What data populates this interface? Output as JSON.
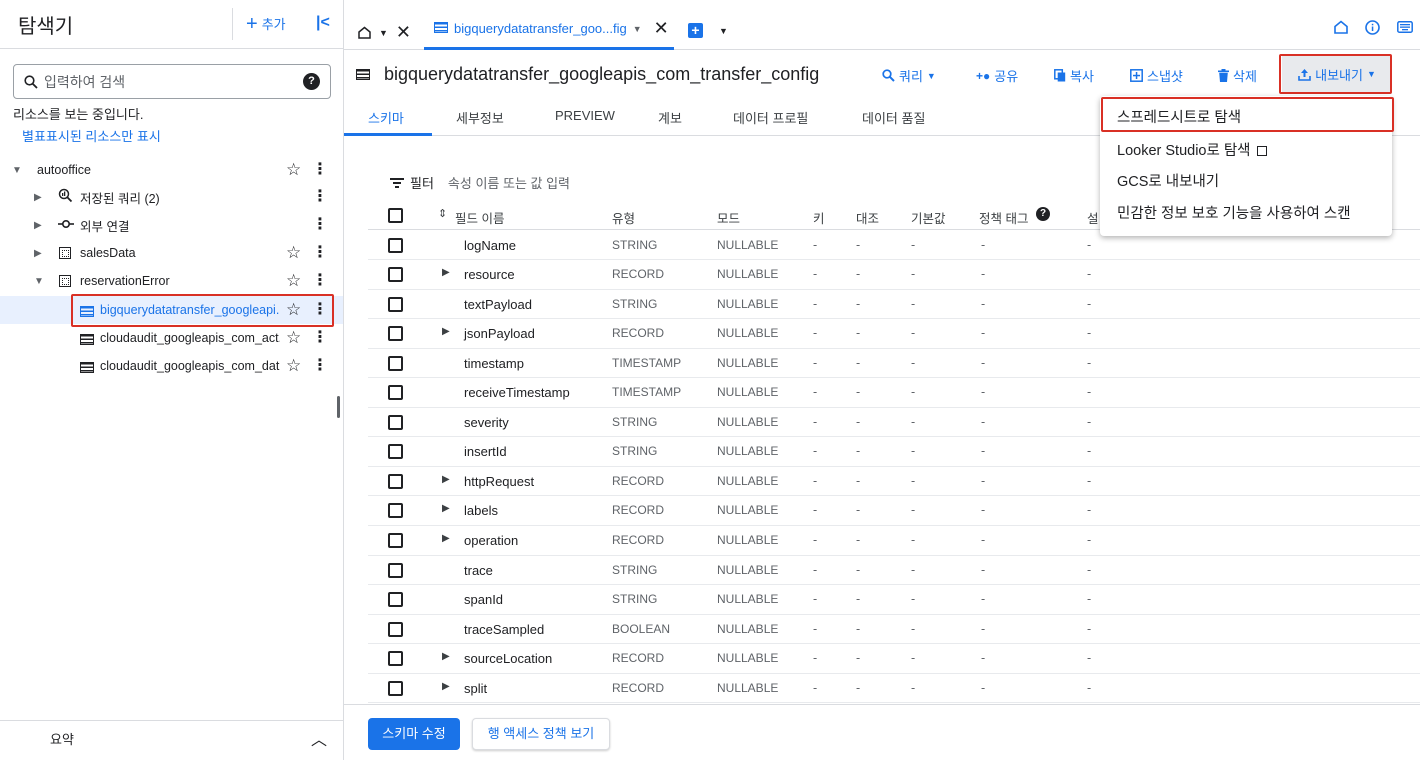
{
  "explorer": {
    "title": "탐색기",
    "add_label": "추가",
    "search_placeholder": "입력하여 검색",
    "info_text": "리소스를 보는 중입니다.",
    "info_link": "별표표시된 리소스만 표시",
    "tree": [
      {
        "label": "autooffice",
        "level": 0,
        "expanded": true,
        "icon": "none",
        "starred": false
      },
      {
        "label": "저장된 쿼리 (2)",
        "level": 1,
        "expanded": false,
        "icon": "saved-query-icon",
        "star": false
      },
      {
        "label": "외부 연결",
        "level": 1,
        "expanded": false,
        "icon": "external-connection-icon",
        "star": false
      },
      {
        "label": "salesData",
        "level": 1,
        "expanded": false,
        "icon": "dataset-icon",
        "star": true
      },
      {
        "label": "reservationError",
        "level": 1,
        "expanded": true,
        "icon": "dataset-icon",
        "star": true
      },
      {
        "label": "bigquerydatatransfer_googleapi...",
        "level": 2,
        "icon": "table-icon",
        "star": true,
        "selected": true
      },
      {
        "label": "cloudaudit_googleapis_com_act...",
        "level": 2,
        "icon": "table-icon",
        "star": true
      },
      {
        "label": "cloudaudit_googleapis_com_dat...",
        "level": 2,
        "icon": "table-icon",
        "star": true
      }
    ],
    "summary_label": "요약"
  },
  "tabs": {
    "active_label": "bigquerydatatransfer_goo...fig"
  },
  "header": {
    "table_title": "bigquerydatatransfer_googleapis_com_transfer_config",
    "actions": {
      "query": "쿼리",
      "share": "공유",
      "copy": "복사",
      "snapshot": "스냅샷",
      "delete": "삭제",
      "export": "내보내기"
    }
  },
  "subtabs": [
    "스키마",
    "세부정보",
    "PREVIEW",
    "계보",
    "데이터 프로필",
    "데이터 품질"
  ],
  "filter": {
    "label": "필터",
    "placeholder": "속성 이름 또는 값 입력"
  },
  "schema_headers": {
    "name": "필드 이름",
    "type": "유형",
    "mode": "모드",
    "key": "키",
    "collation": "대조",
    "default": "기본값",
    "policy_tags": "정책 태그",
    "description": "설"
  },
  "schema_rows": [
    {
      "name": "logName",
      "type": "STRING",
      "mode": "NULLABLE",
      "expandable": false
    },
    {
      "name": "resource",
      "type": "RECORD",
      "mode": "NULLABLE",
      "expandable": true
    },
    {
      "name": "textPayload",
      "type": "STRING",
      "mode": "NULLABLE",
      "expandable": false
    },
    {
      "name": "jsonPayload",
      "type": "RECORD",
      "mode": "NULLABLE",
      "expandable": true
    },
    {
      "name": "timestamp",
      "type": "TIMESTAMP",
      "mode": "NULLABLE",
      "expandable": false
    },
    {
      "name": "receiveTimestamp",
      "type": "TIMESTAMP",
      "mode": "NULLABLE",
      "expandable": false
    },
    {
      "name": "severity",
      "type": "STRING",
      "mode": "NULLABLE",
      "expandable": false
    },
    {
      "name": "insertId",
      "type": "STRING",
      "mode": "NULLABLE",
      "expandable": false
    },
    {
      "name": "httpRequest",
      "type": "RECORD",
      "mode": "NULLABLE",
      "expandable": true
    },
    {
      "name": "labels",
      "type": "RECORD",
      "mode": "NULLABLE",
      "expandable": true
    },
    {
      "name": "operation",
      "type": "RECORD",
      "mode": "NULLABLE",
      "expandable": true
    },
    {
      "name": "trace",
      "type": "STRING",
      "mode": "NULLABLE",
      "expandable": false
    },
    {
      "name": "spanId",
      "type": "STRING",
      "mode": "NULLABLE",
      "expandable": false
    },
    {
      "name": "traceSampled",
      "type": "BOOLEAN",
      "mode": "NULLABLE",
      "expandable": false
    },
    {
      "name": "sourceLocation",
      "type": "RECORD",
      "mode": "NULLABLE",
      "expandable": true
    },
    {
      "name": "split",
      "type": "RECORD",
      "mode": "NULLABLE",
      "expandable": true
    }
  ],
  "empty_cell": "-",
  "bottom": {
    "edit_schema": "스키마 수정",
    "row_access": "행 액세스 정책 보기"
  },
  "export_menu": [
    "스프레드시트로 탐색",
    "Looker Studio로 탐색",
    "GCS로 내보내기",
    "민감한 정보 보호 기능을 사용하여 스캔"
  ],
  "colors": {
    "accent": "#1a73e8",
    "highlight": "#d93025"
  }
}
